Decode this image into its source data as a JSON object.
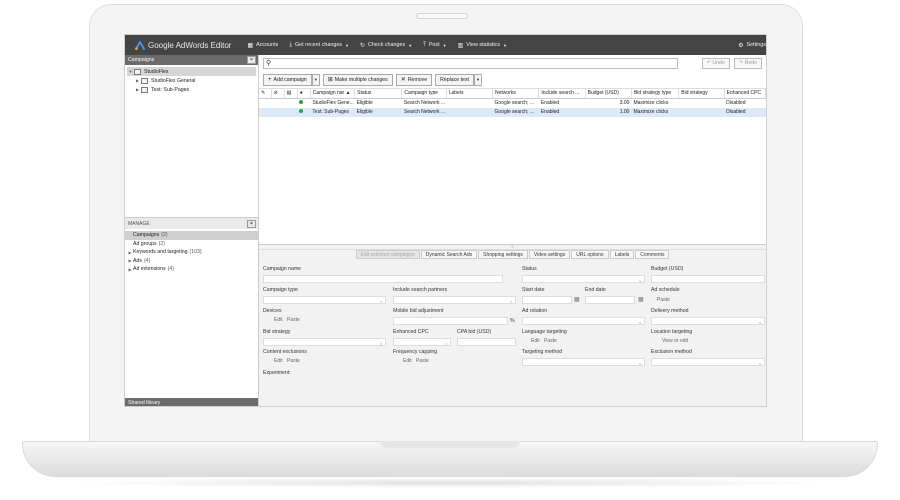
{
  "app": {
    "logo_text": "Google AdWords Editor",
    "toolbar": [
      {
        "icon": "grid-icon",
        "label": "Accounts",
        "dropdown": false
      },
      {
        "icon": "download-icon",
        "label": "Get recent changes",
        "dropdown": true
      },
      {
        "icon": "check-icon",
        "label": "Check changes",
        "dropdown": true
      },
      {
        "icon": "upload-icon",
        "label": "Post",
        "dropdown": true
      },
      {
        "icon": "chart-icon",
        "label": "View statistics",
        "dropdown": true
      }
    ],
    "settings_label": "Settings"
  },
  "sidebar": {
    "campaigns_header": "Campaigns",
    "tree": {
      "account": "StudioFlex",
      "campaigns": [
        "StudioFlex General",
        "Test: Sub-Pages"
      ]
    },
    "manage_header": "MANAGE",
    "manage_items": [
      {
        "label": "Campaigns",
        "count": "(2)",
        "expandable": false,
        "selected": true
      },
      {
        "label": "Ad groups",
        "count": "(2)",
        "expandable": false,
        "selected": false
      },
      {
        "label": "Keywords and targeting",
        "count": "(103)",
        "expandable": true,
        "selected": false
      },
      {
        "label": "Ads",
        "count": "(4)",
        "expandable": true,
        "selected": false
      },
      {
        "label": "Ad extensions",
        "count": "(4)",
        "expandable": true,
        "selected": false
      }
    ],
    "shared_library": "Shared library"
  },
  "search": {
    "placeholder": "",
    "icon": "search-icon"
  },
  "undo_label": "Undo",
  "redo_label": "Redo",
  "actions": {
    "add_campaign": "Add campaign",
    "make_multiple": "Make multiple changes",
    "remove": "Remove",
    "replace_text": "Replace text"
  },
  "grid": {
    "columns": [
      "Campaign nar ▲",
      "Status",
      "Campaign type",
      "Labels",
      "Networks",
      "Include search ...",
      "Budget (USD)",
      "Bid strategy type",
      "Bid strategy",
      "Enhanced CPC"
    ],
    "rows": [
      {
        "name": "StudioFlex Gene...",
        "status": "Eligible",
        "type": "Search Network ...",
        "labels": "",
        "networks": "Google search; ...",
        "include": "Enabled",
        "budget": "3.00",
        "bid_type": "Maximize clicks",
        "bid_strategy": "",
        "ecpc": "Disabled"
      },
      {
        "name": "Test: Sub-Pages",
        "status": "Eligible",
        "type": "Search Network ...",
        "labels": "",
        "networks": "Google search; ...",
        "include": "Enabled",
        "budget": "1.00",
        "bid_type": "Maximize clicks",
        "bid_strategy": "",
        "ecpc": "Disabled"
      }
    ]
  },
  "tabs": [
    "Edit selected campaigns",
    "Dynamic Search Ads",
    "Shopping settings",
    "Video settings",
    "URL options",
    "Labels",
    "Comments"
  ],
  "form": {
    "campaign_name": "Campaign name",
    "status": "Status",
    "budget": "Budget (USD)",
    "campaign_type": "Campaign type",
    "include_search": "Include search partners",
    "start_date": "Start date",
    "end_date": "End date",
    "ad_schedule": "Ad schedule",
    "paste": "Paste",
    "edit": "Edit",
    "devices": "Devices",
    "mobile_bid": "Mobile bid adjustment",
    "percent": "%",
    "ad_rotation": "Ad rotation",
    "delivery_method": "Delivery method",
    "bid_strategy": "Bid strategy",
    "enhanced_cpc": "Enhanced CPC",
    "cpa_bid": "CPA bid (USD)",
    "language_targeting": "Language targeting",
    "location_targeting": "Location targeting",
    "view_or_edit": "View or edit",
    "content_exclusions": "Content exclusions",
    "frequency_capping": "Frequency capping",
    "targeting_method": "Targeting method",
    "exclusion_method": "Exclusion method",
    "experiment": "Experiment:"
  }
}
